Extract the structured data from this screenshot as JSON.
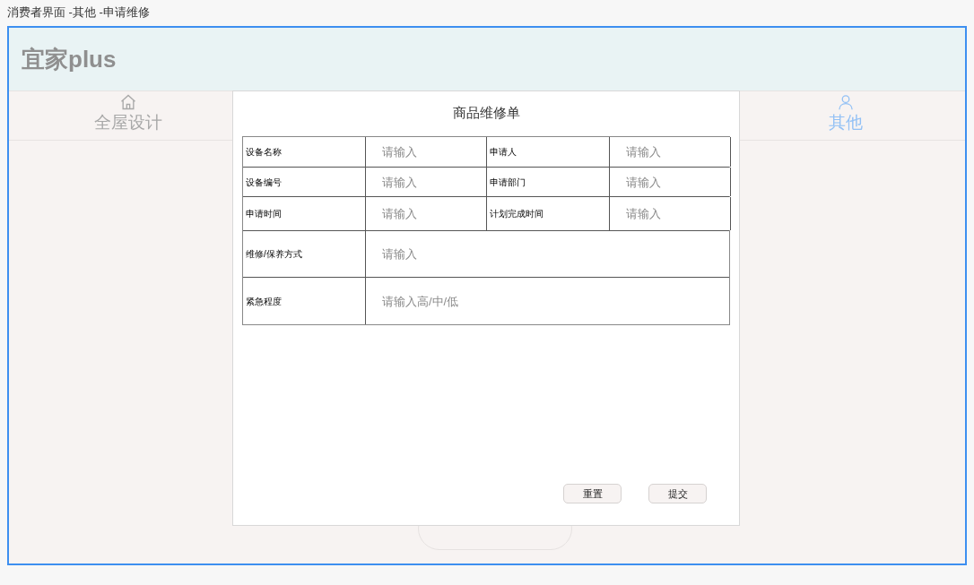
{
  "page_title": "消费者界面 -其他 -申请维修",
  "app": {
    "logo": "宜家plus"
  },
  "tabs": [
    {
      "label": "全屋设计",
      "kind": "home",
      "selected": false
    },
    {
      "label": "其他",
      "kind": "user",
      "selected": true
    }
  ],
  "dialog": {
    "title": "商品维修单",
    "rows": [
      {
        "kind": "pair",
        "fields": [
          {
            "label": "设备名称",
            "placeholder": "请输入"
          },
          {
            "label": "申请人",
            "placeholder": "请输入"
          }
        ]
      },
      {
        "kind": "pair",
        "fields": [
          {
            "label": "设备编号",
            "placeholder": "请输入"
          },
          {
            "label": "申请部门",
            "placeholder": "请输入"
          }
        ]
      },
      {
        "kind": "pair",
        "fields": [
          {
            "label": "申请时间",
            "placeholder": "请输入"
          },
          {
            "label": "计划完成时间",
            "placeholder": "请输入"
          }
        ]
      },
      {
        "kind": "wide",
        "fields": [
          {
            "label": "维修/保养方式",
            "placeholder": "请输入"
          }
        ]
      },
      {
        "kind": "wide",
        "fields": [
          {
            "label": "紧急程度",
            "placeholder": "请输入高/中/低"
          }
        ]
      }
    ],
    "buttons": [
      "重置",
      "提交"
    ]
  }
}
